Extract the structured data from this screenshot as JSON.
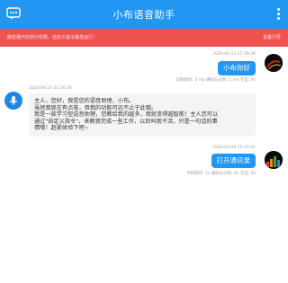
{
  "app": {
    "title": "小布语音助手"
  },
  "warning": {
    "text": "朗音播开启部分权限，自定义指令触发运行！",
    "action": "设置引导"
  },
  "messages": [
    {
      "role": "user",
      "timestamp": "2020-06-23 15:30:36",
      "text": "小布你好",
      "meta": "识别耗时: 0 ms  通知与识别: 1 ms  交互: 0s"
    },
    {
      "role": "assistant",
      "timestamp": "2020-06-23 15:30:36",
      "lines": [
        "主人，您好，我是您的语音助理，小布。",
        "虽然我现在有点笨，但我的功能可远不止于此哦。",
        "我是一款学习型语音助理，您教给我的越多，我就变得越智能！主人您可以",
        "通过\"自定义指令\"，来教我完成一些工作，以后叫我干活，只是一句话的事",
        "情哦！赶紧体验下吧~"
      ]
    },
    {
      "role": "user",
      "timestamp": "2020-03-06 15:33:41",
      "text": "打开通讯录",
      "meta": "识别耗时: 1s  通知与识别: 0s  交互: 0s"
    }
  ]
}
